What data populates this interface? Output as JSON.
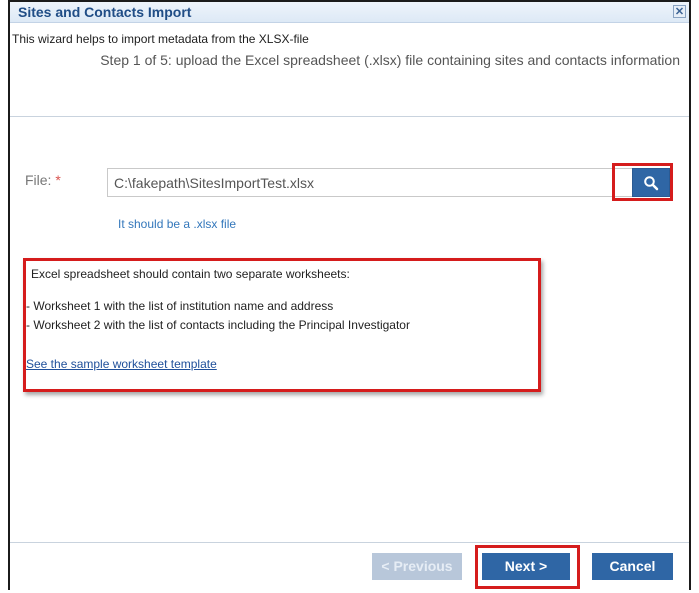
{
  "dialog": {
    "title": "Sites and Contacts Import",
    "close_icon": "✕"
  },
  "header": {
    "intro": "This wizard helps to import metadata from the XLSX-file",
    "step": "Step 1 of 5: upload the Excel spreadsheet (.xlsx) file containing sites and contacts information"
  },
  "file": {
    "label": "File:",
    "required_marker": "*",
    "value": "C:\\fakepath\\SitesImportTest.xlsx",
    "browse_icon": "search-icon",
    "hint": "It should be a .xlsx file"
  },
  "info": {
    "line1": "Excel spreadsheet should contain two separate worksheets:",
    "line2": "- Worksheet 1 with the list of institution name and address",
    "line3": "- Worksheet 2 with the list of contacts including the Principal Investigator",
    "link": "See the sample worksheet template"
  },
  "footer": {
    "previous_label": "< Previous",
    "next_label": "Next >",
    "cancel_label": "Cancel"
  },
  "colors": {
    "accent": "#2f66a5",
    "highlight": "#d51c1c",
    "title": "#204d86"
  }
}
